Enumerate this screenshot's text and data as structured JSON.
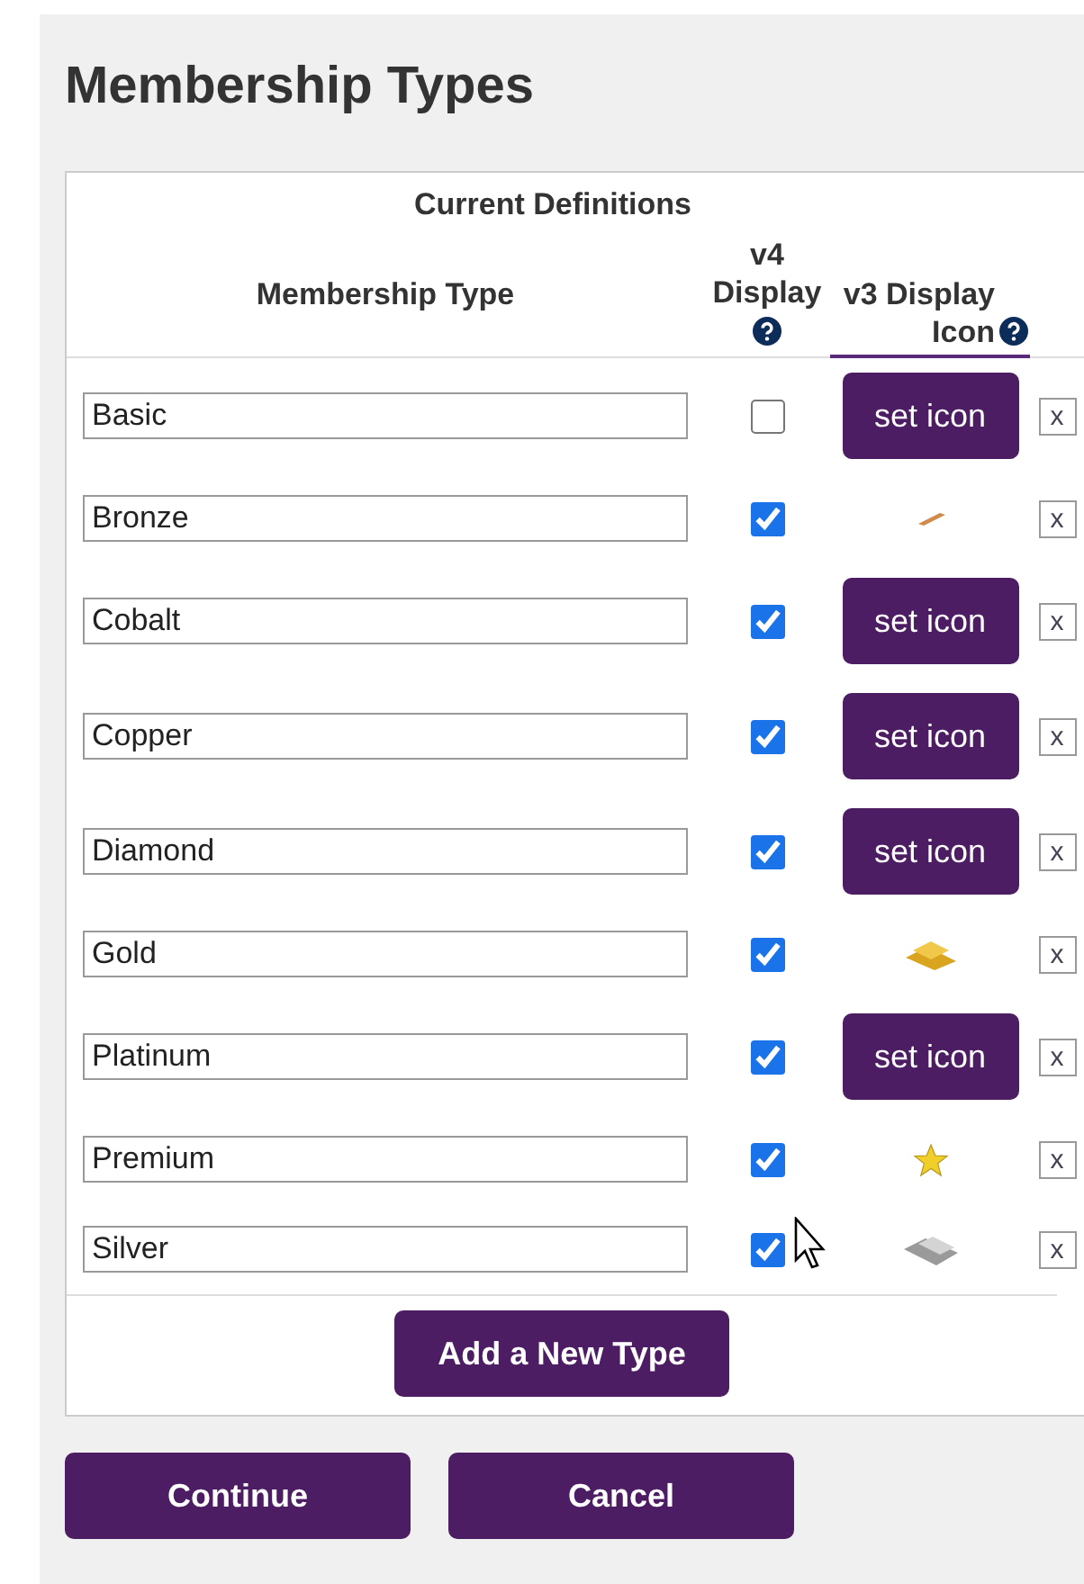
{
  "title": "Membership Types",
  "table": {
    "caption": "Current Definitions",
    "columns": [
      {
        "label": "Membership Type",
        "help": false
      },
      {
        "label": "v4 Display",
        "help": true
      },
      {
        "label": "v3 Display Icon",
        "help": true
      }
    ],
    "rows": [
      {
        "name": "Basic",
        "checked": false,
        "icon": {
          "kind": "button",
          "label": "set icon"
        },
        "delete": "x"
      },
      {
        "name": "Bronze",
        "checked": true,
        "icon": {
          "kind": "bronze-bar"
        },
        "delete": "x"
      },
      {
        "name": "Cobalt",
        "checked": true,
        "icon": {
          "kind": "button",
          "label": "set icon"
        },
        "delete": "x"
      },
      {
        "name": "Copper",
        "checked": true,
        "icon": {
          "kind": "button",
          "label": "set icon"
        },
        "delete": "x"
      },
      {
        "name": "Diamond",
        "checked": true,
        "icon": {
          "kind": "button",
          "label": "set icon"
        },
        "delete": "x"
      },
      {
        "name": "Gold",
        "checked": true,
        "icon": {
          "kind": "gold-bars"
        },
        "delete": "x"
      },
      {
        "name": "Platinum",
        "checked": true,
        "icon": {
          "kind": "button",
          "label": "set icon"
        },
        "delete": "x"
      },
      {
        "name": "Premium",
        "checked": true,
        "icon": {
          "kind": "star"
        },
        "delete": "x"
      },
      {
        "name": "Silver",
        "checked": true,
        "icon": {
          "kind": "silver-bar"
        },
        "delete": "x"
      }
    ],
    "add_button": "Add a New Type"
  },
  "buttons": [
    "Continue",
    "Cancel"
  ]
}
